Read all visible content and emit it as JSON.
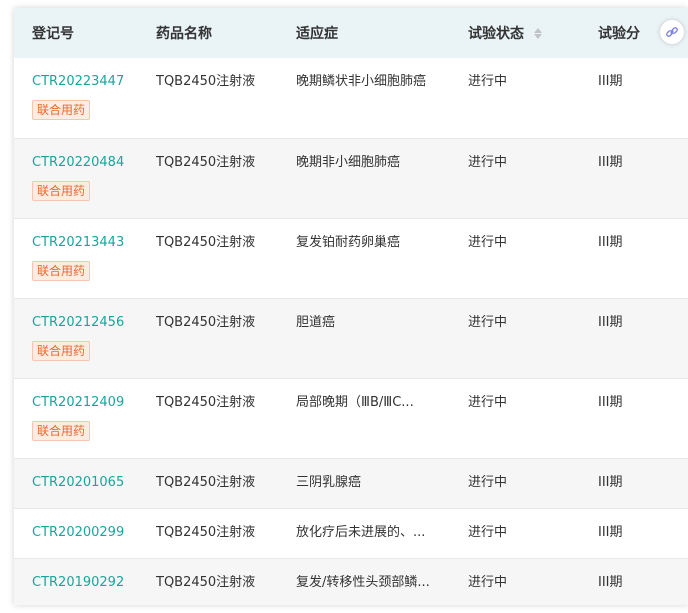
{
  "columns": [
    "登记号",
    "药品名称",
    "适应症",
    "试验状态",
    "试验分"
  ],
  "rows": [
    {
      "reg": "CTR20223447",
      "drug": "TQB2450注射液",
      "indication": "晚期鳞状非小细胞肺癌",
      "status": "进行中",
      "phase": "III期",
      "tag": "联合用药"
    },
    {
      "reg": "CTR20220484",
      "drug": "TQB2450注射液",
      "indication": "晚期非小细胞肺癌",
      "status": "进行中",
      "phase": "III期",
      "tag": "联合用药"
    },
    {
      "reg": "CTR20213443",
      "drug": "TQB2450注射液",
      "indication": "复发铂耐药卵巢癌",
      "status": "进行中",
      "phase": "III期",
      "tag": "联合用药"
    },
    {
      "reg": "CTR20212456",
      "drug": "TQB2450注射液",
      "indication": "胆道癌",
      "status": "进行中",
      "phase": "III期",
      "tag": "联合用药"
    },
    {
      "reg": "CTR20212409",
      "drug": "TQB2450注射液",
      "indication": "局部晚期（ⅢB/ⅢC...",
      "status": "进行中",
      "phase": "III期",
      "tag": "联合用药"
    },
    {
      "reg": "CTR20201065",
      "drug": "TQB2450注射液",
      "indication": "三阴乳腺癌",
      "status": "进行中",
      "phase": "III期",
      "tag": ""
    },
    {
      "reg": "CTR20200299",
      "drug": "TQB2450注射液",
      "indication": "放化疗后未进展的、...",
      "status": "进行中",
      "phase": "III期",
      "tag": ""
    },
    {
      "reg": "CTR20190292",
      "drug": "TQB2450注射液",
      "indication": "复发/转移性头颈部鳞...",
      "status": "进行中",
      "phase": "III期",
      "tag": ""
    }
  ],
  "icons": {
    "sort": "sort-icon",
    "link": "link-icon"
  },
  "colors": {
    "link": "#1aa59a",
    "tag_text": "#e8692e",
    "tag_bg": "#fdece2",
    "header_bg": "#eaf3f6"
  }
}
